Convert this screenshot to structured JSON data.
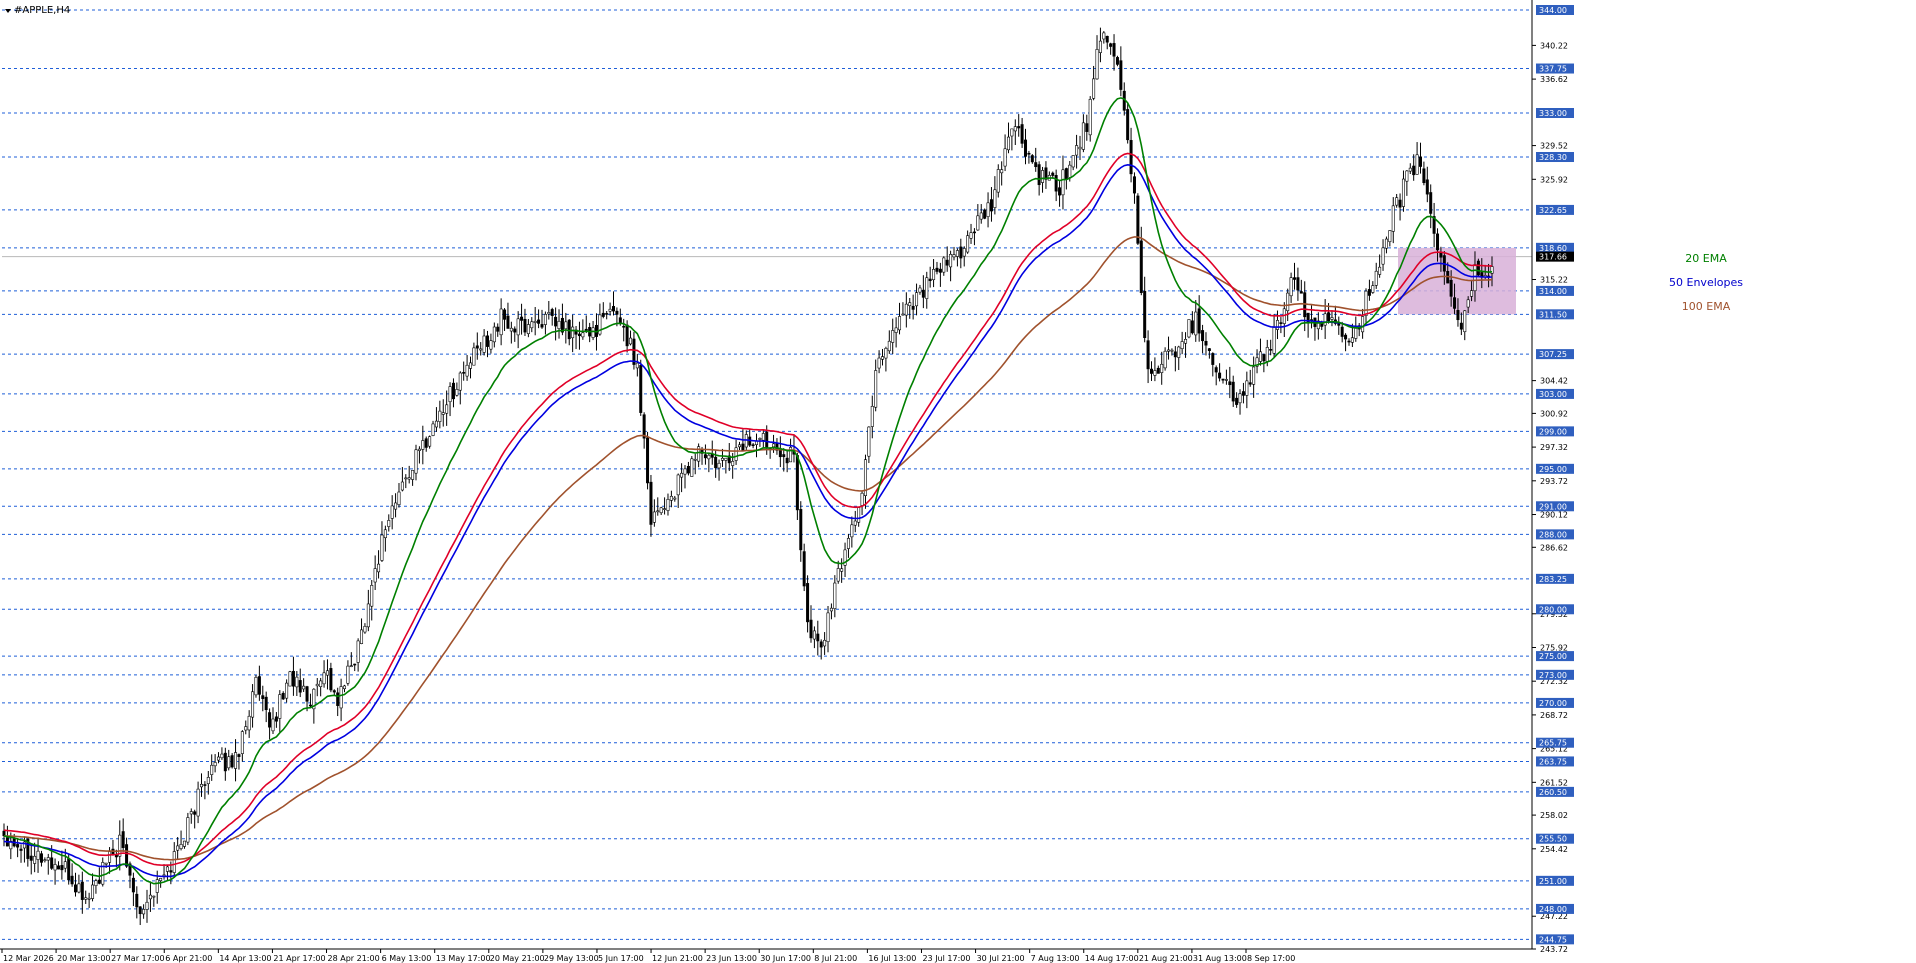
{
  "window": {
    "title": "#APPLE,H4"
  },
  "chart_data": {
    "type": "candlestick",
    "symbol": "#APPLE",
    "timeframe": "H4",
    "ylim": [
      243.72,
      344.0
    ],
    "y_tick_labels": [
      340.22,
      336.62,
      329.52,
      325.92,
      315.22,
      304.42,
      300.92,
      297.32,
      293.72,
      290.12,
      286.62,
      279.52,
      275.92,
      272.32,
      268.72,
      265.12,
      261.52,
      258.02,
      254.42,
      247.22,
      243.72
    ],
    "levels": [
      344.0,
      337.75,
      333.0,
      328.3,
      322.65,
      318.6,
      314.0,
      311.5,
      307.25,
      303.0,
      299.0,
      295.0,
      291.0,
      288.0,
      283.25,
      280.0,
      275.0,
      273.0,
      270.0,
      265.75,
      263.75,
      260.5,
      255.5,
      251.0,
      248.0,
      244.75
    ],
    "current_price": 317.66,
    "x_tick_labels": [
      "12 Mar 2026",
      "20 Mar 13:00",
      "27 Mar 17:00",
      "6 Apr 21:00",
      "14 Apr 13:00",
      "21 Apr 17:00",
      "28 Apr 21:00",
      "6 May 13:00",
      "13 May 17:00",
      "20 May 21:00",
      "29 May 13:00",
      "5 Jun 17:00",
      "12 Jun 21:00",
      "23 Jun 13:00",
      "30 Jun 17:00",
      "8 Jul 21:00",
      "16 Jul 13:00",
      "23 Jul 17:00",
      "30 Jul 21:00",
      "7 Aug 13:00",
      "14 Aug 17:00",
      "21 Aug 21:00",
      "31 Aug 13:00",
      "8 Sep 17:00"
    ],
    "price_path": [
      [
        0,
        256
      ],
      [
        18,
        252
      ],
      [
        24,
        249
      ],
      [
        34,
        255
      ],
      [
        40,
        248
      ],
      [
        48,
        252
      ],
      [
        54,
        257
      ],
      [
        60,
        263
      ],
      [
        68,
        264
      ],
      [
        74,
        272
      ],
      [
        78,
        267
      ],
      [
        84,
        273
      ],
      [
        90,
        270
      ],
      [
        94,
        274
      ],
      [
        98,
        270
      ],
      [
        104,
        276
      ],
      [
        112,
        289
      ],
      [
        118,
        294
      ],
      [
        128,
        301
      ],
      [
        136,
        306
      ],
      [
        146,
        311
      ],
      [
        150,
        310
      ],
      [
        158,
        311
      ],
      [
        170,
        309
      ],
      [
        180,
        312
      ],
      [
        186,
        306
      ],
      [
        190,
        290
      ],
      [
        196,
        292
      ],
      [
        204,
        297
      ],
      [
        210,
        295
      ],
      [
        218,
        298
      ],
      [
        226,
        298
      ],
      [
        232,
        296
      ],
      [
        236,
        278
      ],
      [
        240,
        276
      ],
      [
        244,
        282
      ],
      [
        248,
        288
      ],
      [
        252,
        292
      ],
      [
        256,
        306
      ],
      [
        264,
        312
      ],
      [
        272,
        315
      ],
      [
        280,
        318
      ],
      [
        290,
        323
      ],
      [
        296,
        332
      ],
      [
        304,
        326
      ],
      [
        310,
        325
      ],
      [
        318,
        332
      ],
      [
        322,
        341
      ],
      [
        326,
        339
      ],
      [
        328,
        336
      ],
      [
        332,
        324
      ],
      [
        336,
        305
      ],
      [
        342,
        307
      ],
      [
        350,
        311
      ],
      [
        356,
        306
      ],
      [
        362,
        302
      ],
      [
        368,
        306
      ],
      [
        374,
        310
      ],
      [
        378,
        315
      ],
      [
        382,
        312
      ],
      [
        386,
        310
      ],
      [
        390,
        311
      ],
      [
        396,
        309
      ],
      [
        400,
        313
      ],
      [
        404,
        316
      ],
      [
        408,
        322
      ],
      [
        412,
        326
      ],
      [
        416,
        328
      ],
      [
        420,
        320
      ],
      [
        424,
        315
      ],
      [
        428,
        310
      ],
      [
        432,
        316
      ]
    ],
    "series": [
      {
        "name": "20 EMA",
        "color": "#008000",
        "label_color": "#008000"
      },
      {
        "name": "50 Envelopes",
        "color": "#0000e0",
        "label_color": "#0000cc"
      },
      {
        "name": "",
        "color": "#e00028"
      },
      {
        "name": "100 EMA",
        "color": "#a0522d",
        "label_color": "#a0522d"
      }
    ],
    "highlight_zone": {
      "price_top": 318.6,
      "price_bottom": 311.5,
      "color": "#d8b0d8"
    },
    "colors": {
      "axis_tag": "#2f5fbf",
      "grid_dash": "#1f5fd8",
      "current_tag": "#000000"
    }
  }
}
